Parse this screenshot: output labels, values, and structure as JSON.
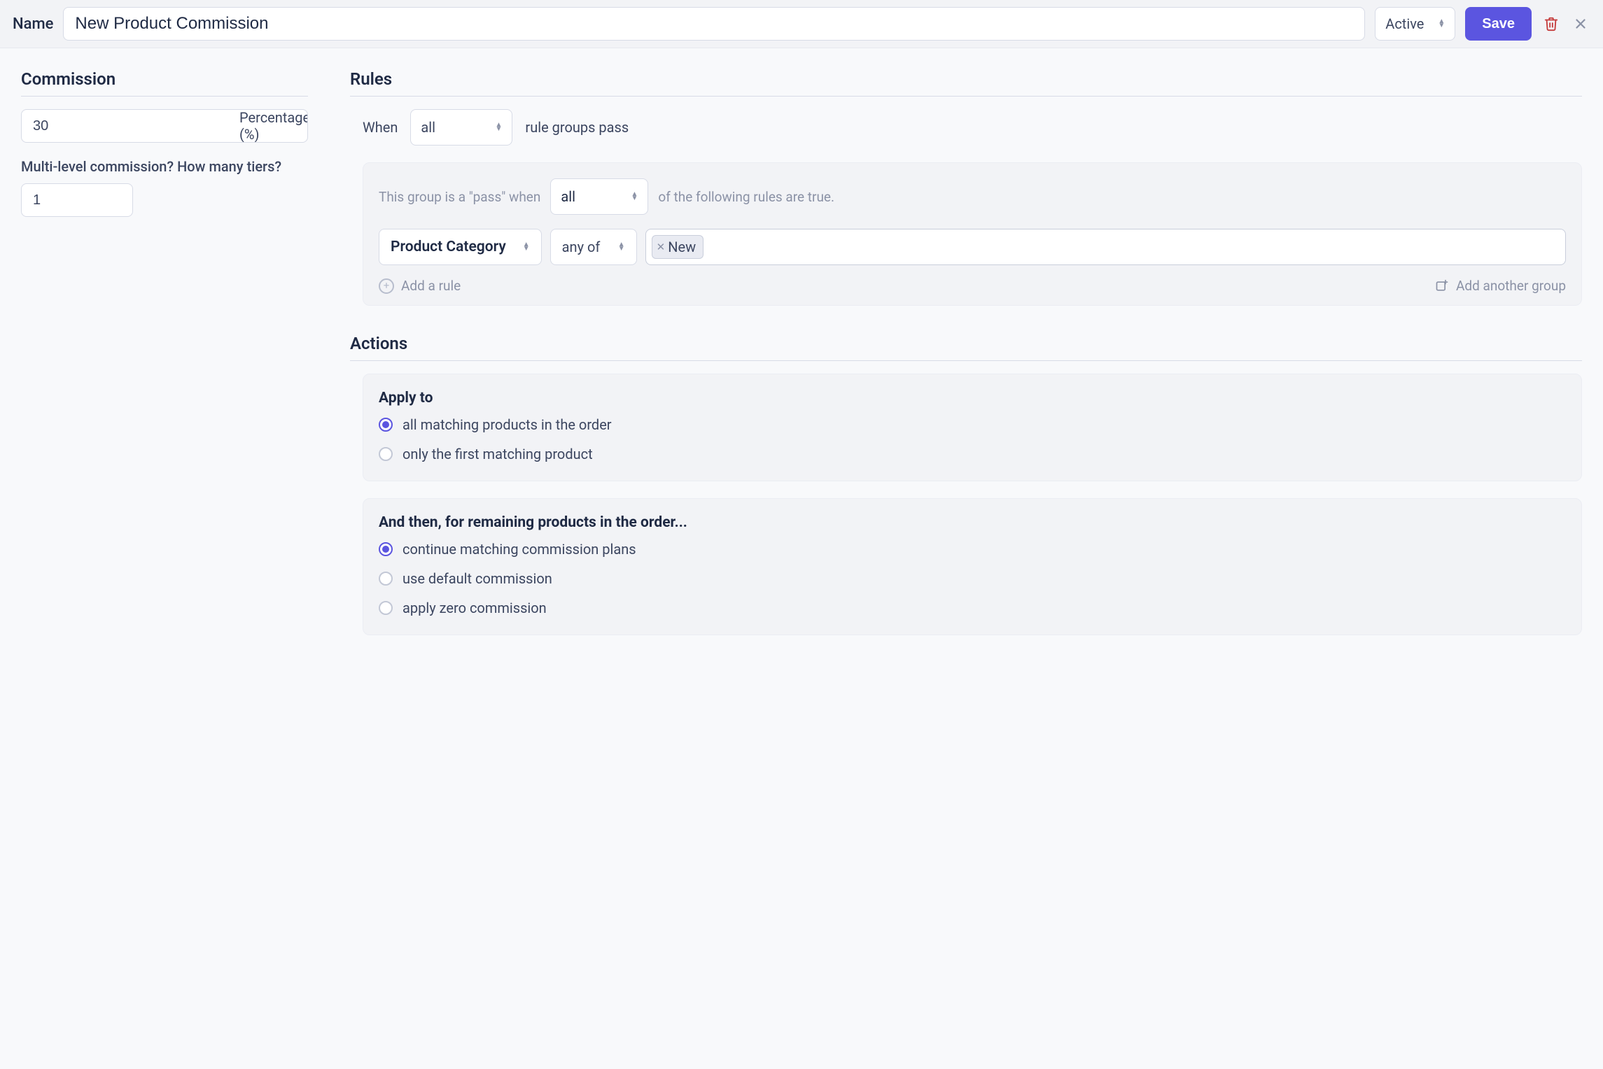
{
  "header": {
    "name_label": "Name",
    "name_value": "New Product Commission",
    "status_label": "Active",
    "save_label": "Save"
  },
  "commission": {
    "title": "Commission",
    "value": "30",
    "type_label": "Percentage (%)",
    "tiers_question": "Multi-level commission? How many tiers?",
    "tiers_value": "1"
  },
  "rules": {
    "title": "Rules",
    "when_prefix": "When",
    "when_mode": "all",
    "when_suffix": "rule groups pass",
    "group": {
      "prefix": "This group is a \"pass\" when",
      "mode": "all",
      "suffix": "of the following rules are true.",
      "rule": {
        "field": "Product Category",
        "operator": "any of",
        "chips": [
          "New"
        ]
      }
    },
    "add_rule_label": "Add a rule",
    "add_group_label": "Add another group"
  },
  "actions": {
    "title": "Actions",
    "apply_to": {
      "heading": "Apply to",
      "options": [
        "all matching products in the order",
        "only the first matching product"
      ],
      "selected": 0
    },
    "then": {
      "heading": "And then, for remaining products in the order...",
      "options": [
        "continue matching commission plans",
        "use default commission",
        "apply zero commission"
      ],
      "selected": 0
    }
  }
}
